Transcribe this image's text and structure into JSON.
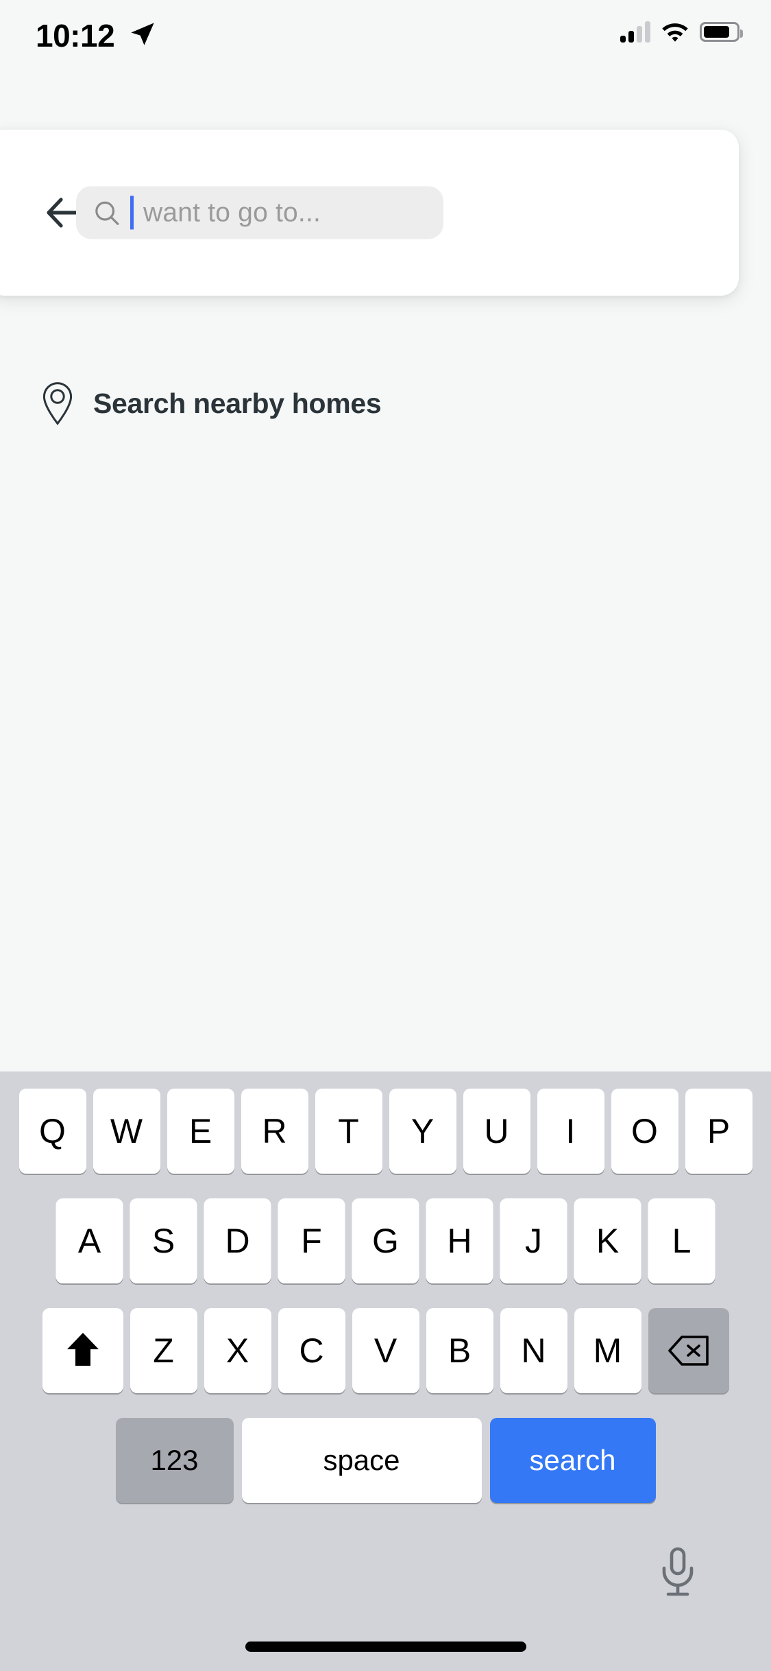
{
  "status_bar": {
    "time": "10:12",
    "location_arrow_icon": "location-arrow-icon",
    "signal_icon": "cellular-signal-icon",
    "wifi_icon": "wifi-icon",
    "battery_icon": "battery-icon",
    "battery_level_percent": 78
  },
  "search_card": {
    "back_icon": "back-arrow-icon",
    "search_icon": "search-icon",
    "input_value": "",
    "placeholder": "want to go to...",
    "cursor_color": "#3F6EF5",
    "field_background": "#EDEDED"
  },
  "suggestions": {
    "nearby": {
      "icon": "map-pin-icon",
      "label": "Search nearby homes"
    }
  },
  "keyboard": {
    "background": "#D1D3D9",
    "row1": [
      "Q",
      "W",
      "E",
      "R",
      "T",
      "Y",
      "U",
      "I",
      "O",
      "P"
    ],
    "row2": [
      "A",
      "S",
      "D",
      "F",
      "G",
      "H",
      "J",
      "K",
      "L"
    ],
    "row3_letters": [
      "Z",
      "X",
      "C",
      "V",
      "B",
      "N",
      "M"
    ],
    "shift_icon": "shift-arrow-icon",
    "backspace_icon": "backspace-icon",
    "numeric_label": "123",
    "space_label": "space",
    "action_label": "search",
    "action_color": "#3478F6",
    "mic_icon": "microphone-icon"
  },
  "home_indicator": {
    "label": "home-indicator"
  }
}
